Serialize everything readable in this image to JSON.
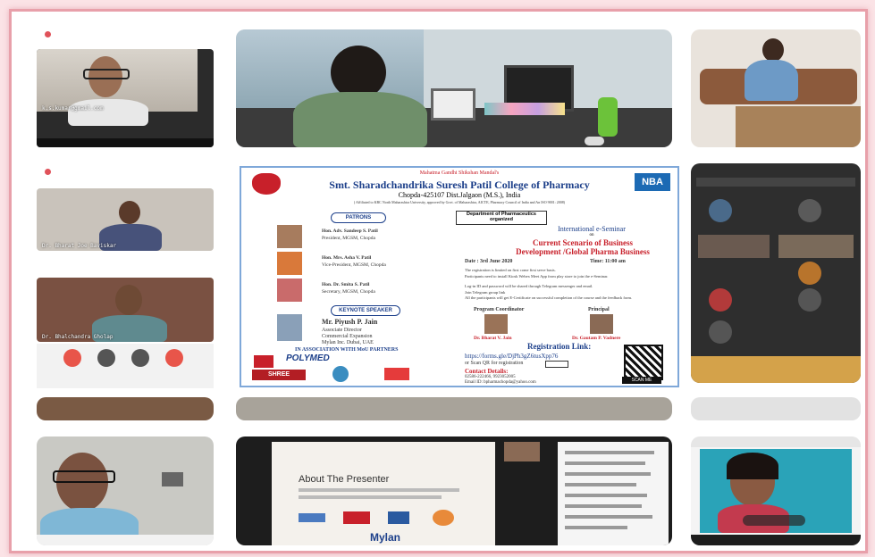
{
  "tiles": {
    "top_left_label": "k.s.kumar@gmail.com",
    "mid_left_1_label": "Dr. Bharat Joe Baviskar",
    "mid_left_2_label": "Dr. Bhalchandra Gholap"
  },
  "poster": {
    "header_small": "Mahatma Gandhi Shikshan Mandal's",
    "college": "Smt. Sharadchandrika Suresh Patil College of Pharmacy",
    "address": "Chopda-425107 Dist.Jalgaon (M.S.), India",
    "affiliation": "( Affiliated to KBC North Maharashtra University, approved by Govt. of Maharashtra, AICTE, Pharmacy Council of India and An ISO 9001: 2008)",
    "badge": "NBA",
    "department": "Department of Pharmaceutics organized",
    "patrons_heading": "PATRONS",
    "patrons": [
      {
        "name": "Hon. Adv. Sandeep S. Patil",
        "role": "President, MGSM, Chopda"
      },
      {
        "name": "Hon. Mrs. Asha V. Patil",
        "role": "Vice-President, MGSM, Chopda"
      },
      {
        "name": "Hon. Dr. Smita S. Patil",
        "role": "Secretary, MGSM, Chopda"
      }
    ],
    "speaker_heading": "KEYNOTE SPEAKER",
    "speaker_name": "Mr. Piyush P. Jain",
    "speaker_role_1": "Associate Director",
    "speaker_role_2": "Commercial Expansion",
    "speaker_role_3": "Mylan Inc. Dubai, UAE",
    "association": "IN ASSOCIATION WITH MoU PARTNERS",
    "logo_polymed": "POLYMED",
    "logo_shree": "SHREE",
    "seminar_type": "International e-Seminar",
    "seminar_on": "on",
    "seminar_title_1": "Current Scenario of Business",
    "seminar_title_2": "Development /Global Pharma Business",
    "date": "Date : 3rd June 2020",
    "time": "Time: 11:00 am",
    "bullets": [
      "The registration is limited on first come first serve basis.",
      "Participants need to install Kiosk Webex Meet App from play store to join the e-Seminar.",
      "Log-in ID and password will be shared through Telegram messenger and email.",
      "Join Telegram group link",
      "All the participants will get E-Certificate on successful completion of the course and the feedback form."
    ],
    "coordinator_heading": "Program Coordinator",
    "principal_heading": "Principal",
    "coordinator_name": "Dr. Bharat V. Jain",
    "principal_name": "Dr. Gautam P. Vadnere",
    "registration_heading": "Registration Link:",
    "registration_link": "https://forms.gle/DjPh3gZ6tusXpp76",
    "qr_text": "or Scan QR for registration",
    "contact_heading": "Contact Details:",
    "contact_phone": "02586-222466, 9923052005",
    "contact_email": "Email ID: bpharmachopda@yahoo.com",
    "scan_label": "SCAN ME"
  },
  "slide": {
    "heading": "About The Presenter",
    "logo_mylan": "Mylan"
  },
  "colors": {
    "accent_red": "#e0525a",
    "poster_blue": "#1c3f8a",
    "poster_red": "#c8202a",
    "frame_pink": "#e8a0aa"
  }
}
